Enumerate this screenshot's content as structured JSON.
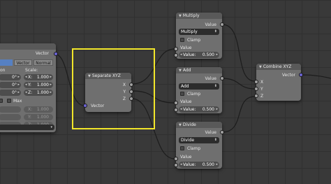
{
  "colors": {
    "background": "#393939",
    "node_body": "#6f6f6f",
    "node_header": "#595959",
    "vector_socket": "#6b63d4",
    "value_socket": "#a1a1a1",
    "selection_box": "#f2e62a",
    "active_button": "#5680c2"
  },
  "left_node": {
    "output_label": "Vector",
    "button_vector": "Vector",
    "button_normal": "Normal",
    "label_location_partial": "on",
    "label_scale": "Scale:",
    "rot_values": [
      "0°",
      "0°",
      "0°"
    ],
    "scale_fields": [
      {
        "axis": "X:",
        "value": "1.000"
      },
      {
        "axis": "Y:",
        "value": "1.000"
      },
      {
        "axis": "Z:",
        "value": "1.000"
      }
    ],
    "max_label": "Max",
    "max_fields": [
      {
        "axis": "X:",
        "value": "1.000"
      },
      {
        "axis": "Y:",
        "value": "1.000"
      },
      {
        "axis": "Z:",
        "value": "1.000"
      }
    ]
  },
  "separate_xyz": {
    "title": "Separate XYZ",
    "outputs": [
      "X",
      "Y",
      "Z"
    ],
    "input": "Vector"
  },
  "multiply": {
    "title": "Multiply",
    "output": "Value",
    "operation": "Multiply",
    "clamp_label": "Clamp",
    "input_label": "Value",
    "field_label": "Value:",
    "field_value": "0.500"
  },
  "add": {
    "title": "Add",
    "output": "Value",
    "operation": "Add",
    "clamp_label": "Clamp",
    "input_label": "Value",
    "field_label": "Value:",
    "field_value": "0.500"
  },
  "divide": {
    "title": "Divide",
    "output": "Value",
    "operation": "Divide",
    "clamp_label": "Clamp",
    "input_label": "Value",
    "field_label": "Value:",
    "field_value": "0.500"
  },
  "combine_xyz": {
    "title": "Combine XYZ",
    "output": "Vector",
    "inputs": [
      "X",
      "Y",
      "Z"
    ]
  }
}
